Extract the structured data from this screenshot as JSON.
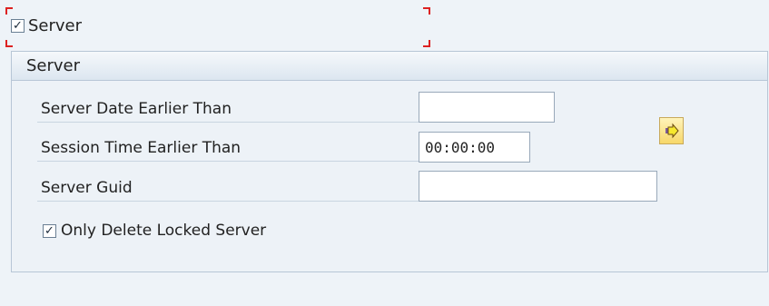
{
  "server_toggle": {
    "label": "Server",
    "checked": true,
    "check_glyph": "✓"
  },
  "group": {
    "title": "Server",
    "fields": [
      {
        "label": "Server Date Earlier Than",
        "value": ""
      },
      {
        "label": "Session Time Earlier Than",
        "value": "00:00:00"
      },
      {
        "label": "Server Guid",
        "value": ""
      }
    ],
    "lock_filter": {
      "label": "Only Delete Locked Server",
      "checked": true,
      "check_glyph": "✓"
    }
  },
  "icons": {
    "checkbox": "check-icon",
    "search_help": "arrow-right-icon"
  },
  "colors": {
    "focus": "#dd2222",
    "search_button": "#f7d86a"
  }
}
